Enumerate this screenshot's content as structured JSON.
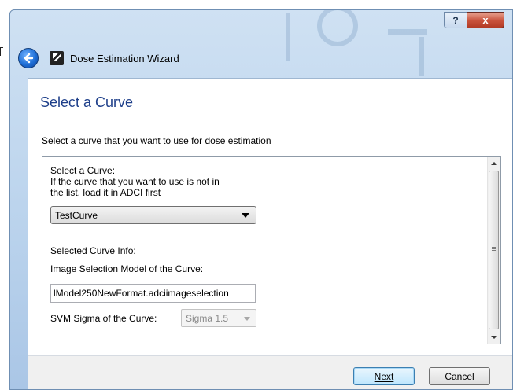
{
  "window": {
    "title": "Dose Estimation Wizard",
    "help_glyph": "?",
    "close_glyph": "x"
  },
  "page": {
    "title": "Select a Curve",
    "subtitle": "Select a curve that you want to use for dose estimation"
  },
  "form": {
    "select_label": "Select a Curve:",
    "select_hint_line1": "If the curve that you want to use is not in",
    "select_hint_line2": "the list, load it in ADCI first",
    "curve_selected": "TestCurve",
    "info_heading": "Selected Curve Info:",
    "image_model_label": "Image Selection Model of the Curve:",
    "image_model_value": "lModel250NewFormat.adciimageselection",
    "svm_label": "SVM Sigma of the Curve:",
    "svm_value": "Sigma 1.5"
  },
  "footer": {
    "next_label": "Next",
    "cancel_label": "Cancel"
  },
  "colors": {
    "title_blue": "#1e3f8a",
    "close_red": "#c8513b",
    "frame_blue": "#b9d2ec"
  }
}
